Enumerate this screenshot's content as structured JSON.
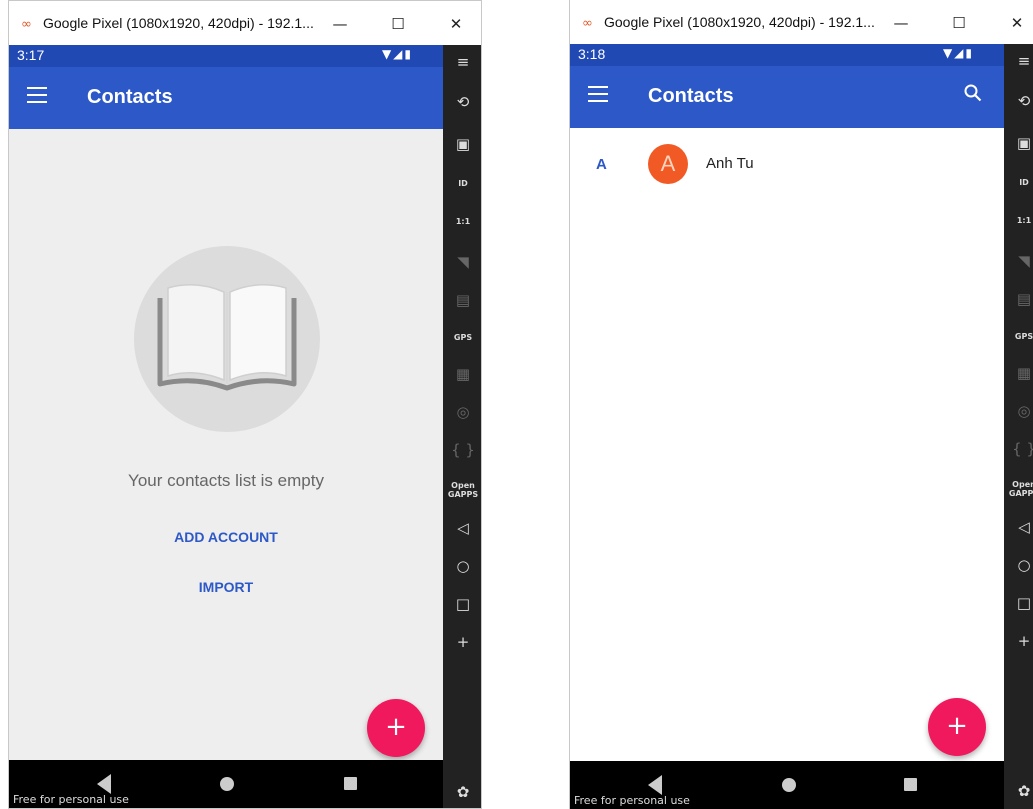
{
  "left": {
    "window": {
      "title": "Google Pixel (1080x1920, 420dpi) - 192.1...",
      "minimize": "—",
      "maximize": "☐",
      "close": "✕"
    },
    "status": {
      "time": "3:17"
    },
    "appbar": {
      "title": "Contacts"
    },
    "empty": {
      "message": "Your contacts list is empty",
      "add_account": "ADD ACCOUNT",
      "import": "IMPORT"
    },
    "fab": "+",
    "footer": "Free for personal use"
  },
  "right": {
    "window": {
      "title": "Google Pixel (1080x1920, 420dpi) - 192.1...",
      "minimize": "—",
      "maximize": "☐",
      "close": "✕"
    },
    "status": {
      "time": "3:18"
    },
    "appbar": {
      "title": "Contacts"
    },
    "contacts": [
      {
        "section": "A",
        "initial": "A",
        "name": "Anh Tu"
      }
    ],
    "fab": "+",
    "footer": "Free for personal use"
  },
  "sidebar": {
    "items": [
      {
        "icon": "menu-icon",
        "glyph": "≡"
      },
      {
        "icon": "rotate-icon",
        "glyph": "⟲"
      },
      {
        "icon": "screen-record-icon",
        "glyph": "▣"
      },
      {
        "icon": "id-icon",
        "glyph": "ID"
      },
      {
        "icon": "pixel-perfect-icon",
        "glyph": "1:1"
      },
      {
        "icon": "broadcast-icon",
        "glyph": "◥"
      },
      {
        "icon": "sd-card-icon",
        "glyph": "▤"
      },
      {
        "icon": "gps-icon",
        "glyph": "GPS"
      },
      {
        "icon": "video-icon",
        "glyph": "▦"
      },
      {
        "icon": "fingerprint-icon",
        "glyph": "◎"
      },
      {
        "icon": "code-icon",
        "glyph": "{ }"
      },
      {
        "icon": "open-gapps-icon",
        "glyph": "Open GAPPS"
      },
      {
        "icon": "back-icon",
        "glyph": "◁"
      },
      {
        "icon": "home-icon",
        "glyph": "○"
      },
      {
        "icon": "recents-icon",
        "glyph": "□"
      },
      {
        "icon": "plus-icon",
        "glyph": "+"
      },
      {
        "icon": "settings-icon",
        "glyph": "✿"
      }
    ]
  },
  "colors": {
    "primary": "#2c58c8",
    "statusbar": "#2049b3",
    "fab": "#f0195d",
    "avatar": "#f15a24"
  }
}
